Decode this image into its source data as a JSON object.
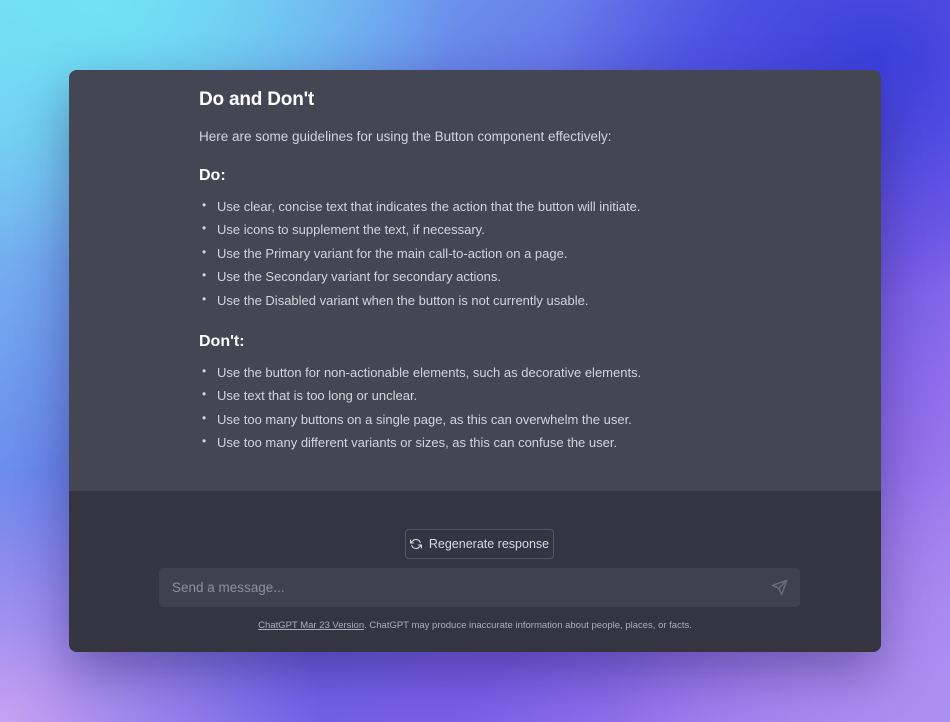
{
  "message": {
    "heading": "Do and Don't",
    "intro": "Here are some guidelines for using the Button component effectively:",
    "do": {
      "heading": "Do:",
      "items": [
        "Use clear, concise text that indicates the action that the button will initiate.",
        "Use icons to supplement the text, if necessary.",
        "Use the Primary variant for the main call-to-action on a page.",
        "Use the Secondary variant for secondary actions.",
        "Use the Disabled variant when the button is not currently usable."
      ]
    },
    "dont": {
      "heading": "Don't:",
      "items": [
        "Use the button for non-actionable elements, such as decorative elements.",
        "Use text that is too long or unclear.",
        "Use too many buttons on a single page, as this can overwhelm the user.",
        "Use too many different variants or sizes, as this can confuse the user."
      ]
    }
  },
  "controls": {
    "regenerate_label": "Regenerate response",
    "regenerate_icon": "refresh-icon",
    "input_placeholder": "Send a message...",
    "send_icon": "send-icon"
  },
  "footer": {
    "version_link": "ChatGPT Mar 23 Version",
    "disclaimer": ". ChatGPT may produce inaccurate information about people, places, or facts."
  },
  "colors": {
    "message_bg": "#444654",
    "composer_bg": "#343541",
    "input_bg": "#40414f",
    "text": "#d1d5db",
    "heading": "#ffffff"
  }
}
